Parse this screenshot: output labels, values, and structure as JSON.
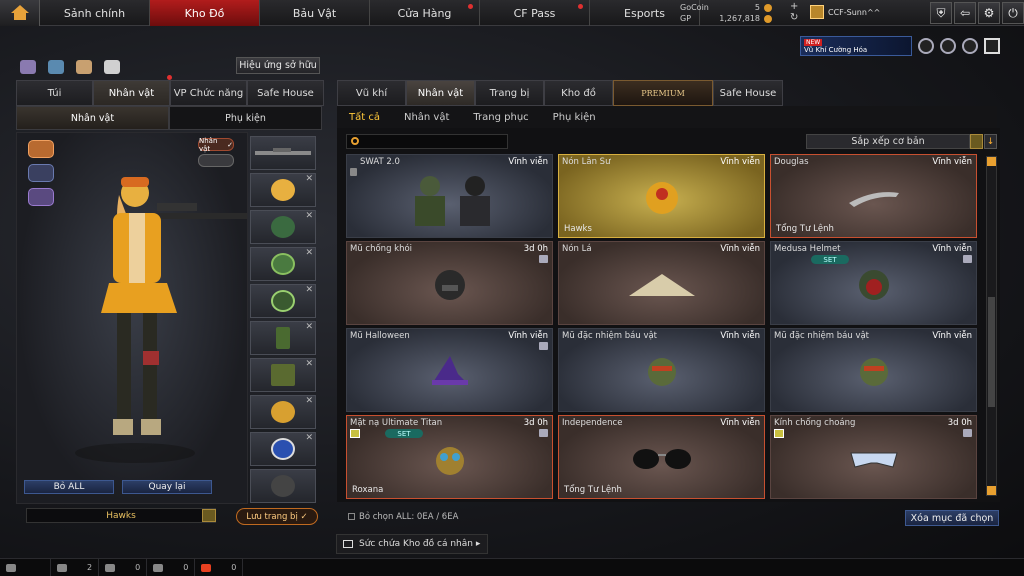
{
  "nav": {
    "tabs": [
      {
        "label": "Sảnh chính",
        "active": false,
        "dot": false
      },
      {
        "label": "Kho Đồ",
        "active": true,
        "dot": false
      },
      {
        "label": "Bảu Vật",
        "active": false,
        "dot": false
      },
      {
        "label": "Cửa Hàng",
        "active": false,
        "dot": true
      },
      {
        "label": "CF Pass",
        "active": false,
        "dot": true
      },
      {
        "label": "Esports",
        "active": false,
        "dot": false
      }
    ]
  },
  "currency": {
    "gocoin_label": "GoCoin",
    "gocoin_value": "5",
    "gp_label": "GP",
    "gp_value": "1,267,818"
  },
  "user": {
    "name": "CCF-Sunn^^"
  },
  "promo": {
    "badge": "NEW",
    "text": "Vũ Khí Cường Hóa"
  },
  "left": {
    "effect_button": "Hiệu ứng sở hữu",
    "tabs": [
      "Túi",
      "Nhân vật",
      "VP Chức năng",
      "Safe House"
    ],
    "subtabs": [
      "Nhân vật",
      "Phụ kiện"
    ],
    "badge": "Nhân vật",
    "buttons": {
      "drop_all": "Bỏ ALL",
      "back": "Quay lại"
    },
    "character_name": "Hawks",
    "save_button": "Lưu trang bị"
  },
  "right": {
    "tabs": [
      "Vũ khí",
      "Nhân vật",
      "Trang bị",
      "Kho đồ",
      "PREMIUM",
      "Safe House"
    ],
    "subtabs": [
      "Tất cả",
      "Nhân vật",
      "Trang phục",
      "Phụ kiện"
    ],
    "sort_label": "Sắp xếp cơ bản",
    "items": [
      {
        "name": "SWAT 2.0",
        "duration": "Vĩnh viễn",
        "owner": "",
        "style": "normal",
        "set": false,
        "lock": false
      },
      {
        "name": "Nón Lân Sư",
        "duration": "Vĩnh viễn",
        "owner": "Hawks",
        "style": "gold",
        "set": false,
        "lock": false
      },
      {
        "name": "Douglas",
        "duration": "Vĩnh viễn",
        "owner": "Tổng Tư Lệnh",
        "style": "brown-red",
        "set": false,
        "lock": false
      },
      {
        "name": "Mũ chống khói",
        "duration": "3d 0h",
        "owner": "",
        "style": "brown",
        "set": false,
        "lock": true
      },
      {
        "name": "Nón Lá",
        "duration": "Vĩnh viễn",
        "owner": "",
        "style": "brown",
        "set": false,
        "lock": false
      },
      {
        "name": "Medusa Helmet",
        "duration": "Vĩnh viễn",
        "owner": "",
        "style": "normal",
        "set": true,
        "lock": true
      },
      {
        "name": "Mũ Halloween",
        "duration": "Vĩnh viễn",
        "owner": "",
        "style": "normal",
        "set": false,
        "lock": true
      },
      {
        "name": "Mũ đặc nhiệm báu vật",
        "duration": "Vĩnh viễn",
        "owner": "",
        "style": "normal",
        "set": false,
        "lock": false
      },
      {
        "name": "Mũ đặc nhiệm báu vật",
        "duration": "Vĩnh viễn",
        "owner": "",
        "style": "normal",
        "set": false,
        "lock": false
      },
      {
        "name": "Mặt nạ Ultimate Titan",
        "duration": "3d 0h",
        "owner": "Roxana",
        "style": "brown-red",
        "set": true,
        "lock": true
      },
      {
        "name": "Independence",
        "duration": "Vĩnh viễn",
        "owner": "Tổng Tư Lệnh",
        "style": "brown-red",
        "set": false,
        "lock": false
      },
      {
        "name": "Kính chống choáng",
        "duration": "3d 0h",
        "owner": "",
        "style": "brown",
        "set": false,
        "lock": true
      }
    ],
    "select_info": "Bỏ chọn ALL: 0EA / 6EA",
    "delete_button": "Xóa mục đã chọn",
    "capacity": "Sức chứa Kho đồ cá nhân"
  },
  "status": {
    "friends": "2",
    "invites": "0",
    "messages": "0",
    "gifts": "0"
  }
}
